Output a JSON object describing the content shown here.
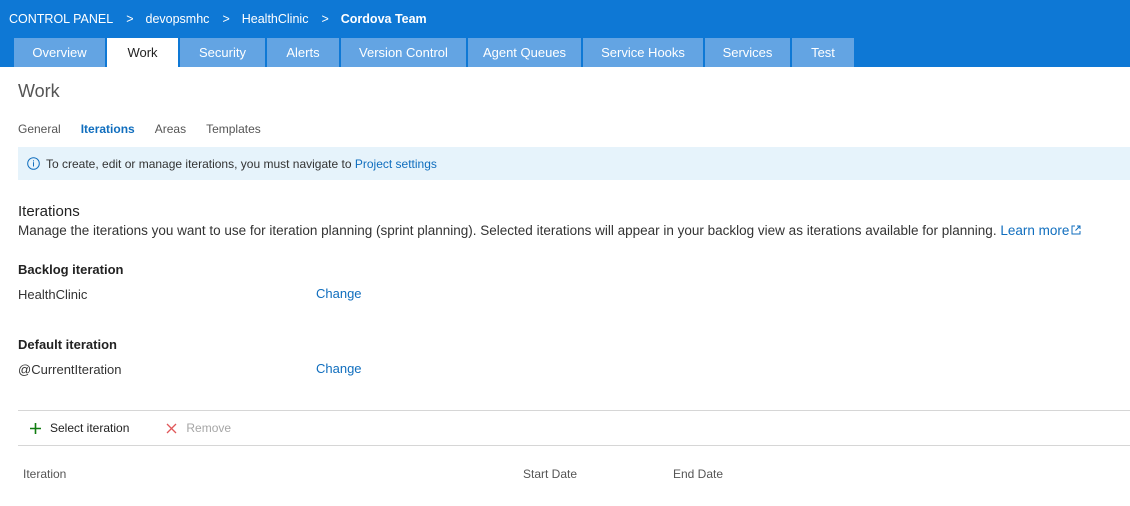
{
  "breadcrumb": {
    "items": [
      "CONTROL PANEL",
      "devopsmhc",
      "HealthClinic"
    ],
    "current": "Cordova Team",
    "separator": ">"
  },
  "tabs": [
    {
      "label": "Overview",
      "active": false
    },
    {
      "label": "Work",
      "active": true
    },
    {
      "label": "Security",
      "active": false
    },
    {
      "label": "Alerts",
      "active": false
    },
    {
      "label": "Version Control",
      "active": false
    },
    {
      "label": "Agent Queues",
      "active": false
    },
    {
      "label": "Service Hooks",
      "active": false
    },
    {
      "label": "Services",
      "active": false
    },
    {
      "label": "Test",
      "active": false
    }
  ],
  "page": {
    "title": "Work"
  },
  "subtabs": [
    {
      "label": "General",
      "active": false
    },
    {
      "label": "Iterations",
      "active": true
    },
    {
      "label": "Areas",
      "active": false
    },
    {
      "label": "Templates",
      "active": false
    }
  ],
  "info": {
    "icon": "info-icon",
    "text": "To create, edit or manage iterations, you must navigate to",
    "link": "Project settings"
  },
  "section": {
    "title": "Iterations",
    "description": "Manage the iterations you want to use for iteration planning (sprint planning). Selected iterations will appear in your backlog view as iterations available for planning.",
    "learn_more": "Learn more"
  },
  "backlog_iteration": {
    "label": "Backlog iteration",
    "value": "HealthClinic",
    "change": "Change"
  },
  "default_iteration": {
    "label": "Default iteration",
    "value": "@CurrentIteration",
    "change": "Change"
  },
  "toolbar": {
    "select_label": "Select iteration",
    "remove_label": "Remove",
    "select_icon": "plus-icon",
    "remove_icon": "close-icon"
  },
  "table": {
    "columns": [
      "Iteration",
      "Start Date",
      "End Date"
    ]
  },
  "colors": {
    "header_bg": "#0e78d5",
    "tab_bg": "#63a4e3",
    "link": "#106ebe",
    "info_bg": "#e6f3fb",
    "add_green": "#107c10",
    "remove_red": "#e0585a"
  }
}
